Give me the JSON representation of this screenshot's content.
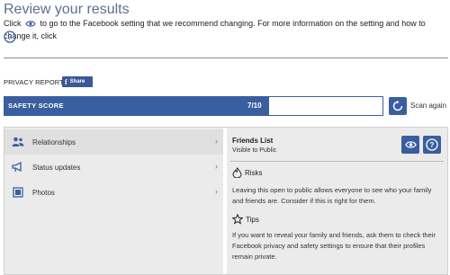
{
  "header": {
    "title": "Review your results",
    "intro_before": "Click",
    "intro_after": "to go to the Facebook setting that we recommend changing. For more information on the setting and how to change it, click"
  },
  "privacy_report": {
    "label": "PRIVACY REPORT",
    "share_icon_text": "f",
    "share_label": "Share"
  },
  "safety_score": {
    "label": "SAFETY SCORE",
    "value_text": "7/10",
    "score": 7,
    "max": 10,
    "scan_label": "Scan again"
  },
  "sidebar": {
    "items": [
      {
        "label": "Relationships",
        "icon": "people-icon",
        "active": true
      },
      {
        "label": "Status updates",
        "icon": "megaphone-icon",
        "active": false
      },
      {
        "label": "Photos",
        "icon": "photo-icon",
        "active": false
      }
    ]
  },
  "detail": {
    "title": "Friends List",
    "subtitle": "Visible to Public",
    "risks_heading": "Risks",
    "risks_text": "Leaving this open to public allows everyone to see who your family and friends are. Consider if this is right for them.",
    "tips_heading": "Tips",
    "tips_text": "If you want to reveal your family and friends, ask them to check their Facebook privacy and safety settings to ensure that their profiles remain private."
  },
  "colors": {
    "accent": "#3a5fa0",
    "facebook": "#3b5998",
    "title": "#5f6f8a",
    "panel": "#ebebeb"
  }
}
